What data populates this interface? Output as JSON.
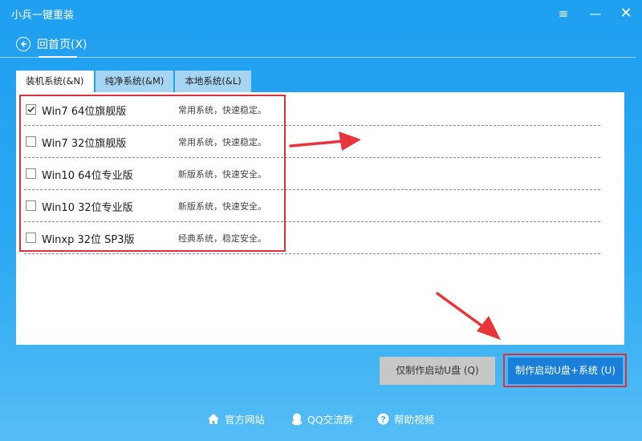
{
  "app": {
    "title": "小兵一键重装"
  },
  "window": {
    "menu_glyph": "≡",
    "min_glyph": "—",
    "close_glyph": "✕"
  },
  "nav": {
    "back_label": "回首页(X)"
  },
  "tabs": [
    {
      "label": "装机系统(&N)",
      "active": true
    },
    {
      "label": "纯净系统(&M)",
      "active": false
    },
    {
      "label": "本地系统(&L)",
      "active": false
    }
  ],
  "systems": [
    {
      "name": "Win7 64位旗舰版",
      "desc": "常用系统，快速稳定。",
      "checked": true
    },
    {
      "name": "Win7 32位旗舰版",
      "desc": "常用系统，快速稳定。",
      "checked": false
    },
    {
      "name": "Win10 64位专业版",
      "desc": "新版系统，快速安全。",
      "checked": false
    },
    {
      "name": "Win10 32位专业版",
      "desc": "新版系统，快速安全。",
      "checked": false
    },
    {
      "name": "Winxp 32位 SP3版",
      "desc": "经典系统，稳定安全。",
      "checked": false
    }
  ],
  "buttons": {
    "usb_only": "仅制作启动U盘 (Q)",
    "usb_and_system": "制作启动U盘+系统 (U)"
  },
  "footer": {
    "website": "官方网站",
    "qq_group": "QQ交流群",
    "help_video": "帮助视频"
  },
  "colors": {
    "background": "#2aa8f2",
    "highlight_red": "#e0303a",
    "primary_button": "#1a7fd8",
    "secondary_button": "#c7c7c7"
  }
}
